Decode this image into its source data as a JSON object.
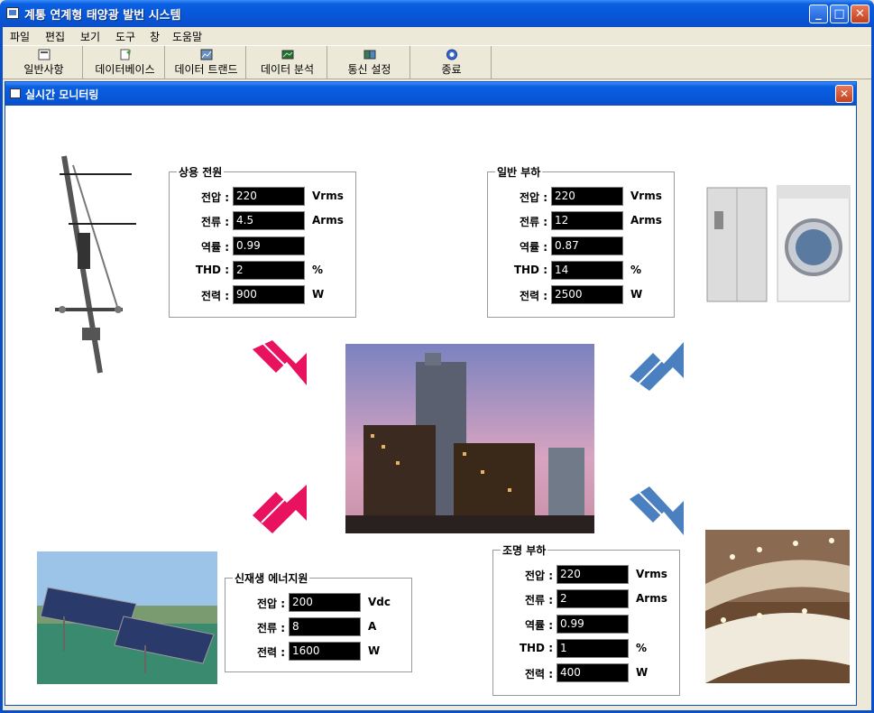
{
  "window": {
    "title": "계통 연계형 태양광 발번 시스템"
  },
  "menu": [
    "파일",
    "편집",
    "보기",
    "도구",
    "창",
    "도움말"
  ],
  "toolbar": [
    "일반사항",
    "데이터베이스",
    "데이터 트랜드",
    "데이터 분석",
    "통신 설정",
    "종료"
  ],
  "child": {
    "title": "실시간 모니터링"
  },
  "utility": {
    "title": "상용 전원",
    "rows": [
      {
        "label": "전압 :",
        "value": "220",
        "unit": "Vrms"
      },
      {
        "label": "전류 :",
        "value": "4.5",
        "unit": "Arms"
      },
      {
        "label": "역률 :",
        "value": "0.99",
        "unit": ""
      },
      {
        "label": "THD :",
        "value": "2",
        "unit": "%"
      },
      {
        "label": "전력 :",
        "value": "900",
        "unit": "W"
      }
    ]
  },
  "general_load": {
    "title": "일반 부하",
    "rows": [
      {
        "label": "전압 :",
        "value": "220",
        "unit": "Vrms"
      },
      {
        "label": "전류 :",
        "value": "12",
        "unit": "Arms"
      },
      {
        "label": "역률 :",
        "value": "0.87",
        "unit": ""
      },
      {
        "label": "THD :",
        "value": "14",
        "unit": "%"
      },
      {
        "label": "전력 :",
        "value": "2500",
        "unit": "W"
      }
    ]
  },
  "renewable": {
    "title": "신재생 에너지원",
    "rows": [
      {
        "label": "전압 :",
        "value": "200",
        "unit": "Vdc"
      },
      {
        "label": "전류 :",
        "value": "8",
        "unit": "A"
      },
      {
        "label": "전력 :",
        "value": "1600",
        "unit": "W"
      }
    ]
  },
  "lighting_load": {
    "title": "조명 부하",
    "rows": [
      {
        "label": "전압 :",
        "value": "220",
        "unit": "Vrms"
      },
      {
        "label": "전류 :",
        "value": "2",
        "unit": "Arms"
      },
      {
        "label": "역률 :",
        "value": "0.99",
        "unit": ""
      },
      {
        "label": "THD :",
        "value": "1",
        "unit": "%"
      },
      {
        "label": "전력 :",
        "value": "400",
        "unit": "W"
      }
    ]
  },
  "colors": {
    "input_arrow": "#e8125e",
    "output_arrow": "#4a7fc0",
    "titlebar": "#0a5fe0"
  },
  "icons": [
    "app-icon",
    "general-info-icon",
    "database-icon",
    "data-trend-icon",
    "data-analysis-icon",
    "comm-settings-icon",
    "exit-icon"
  ]
}
